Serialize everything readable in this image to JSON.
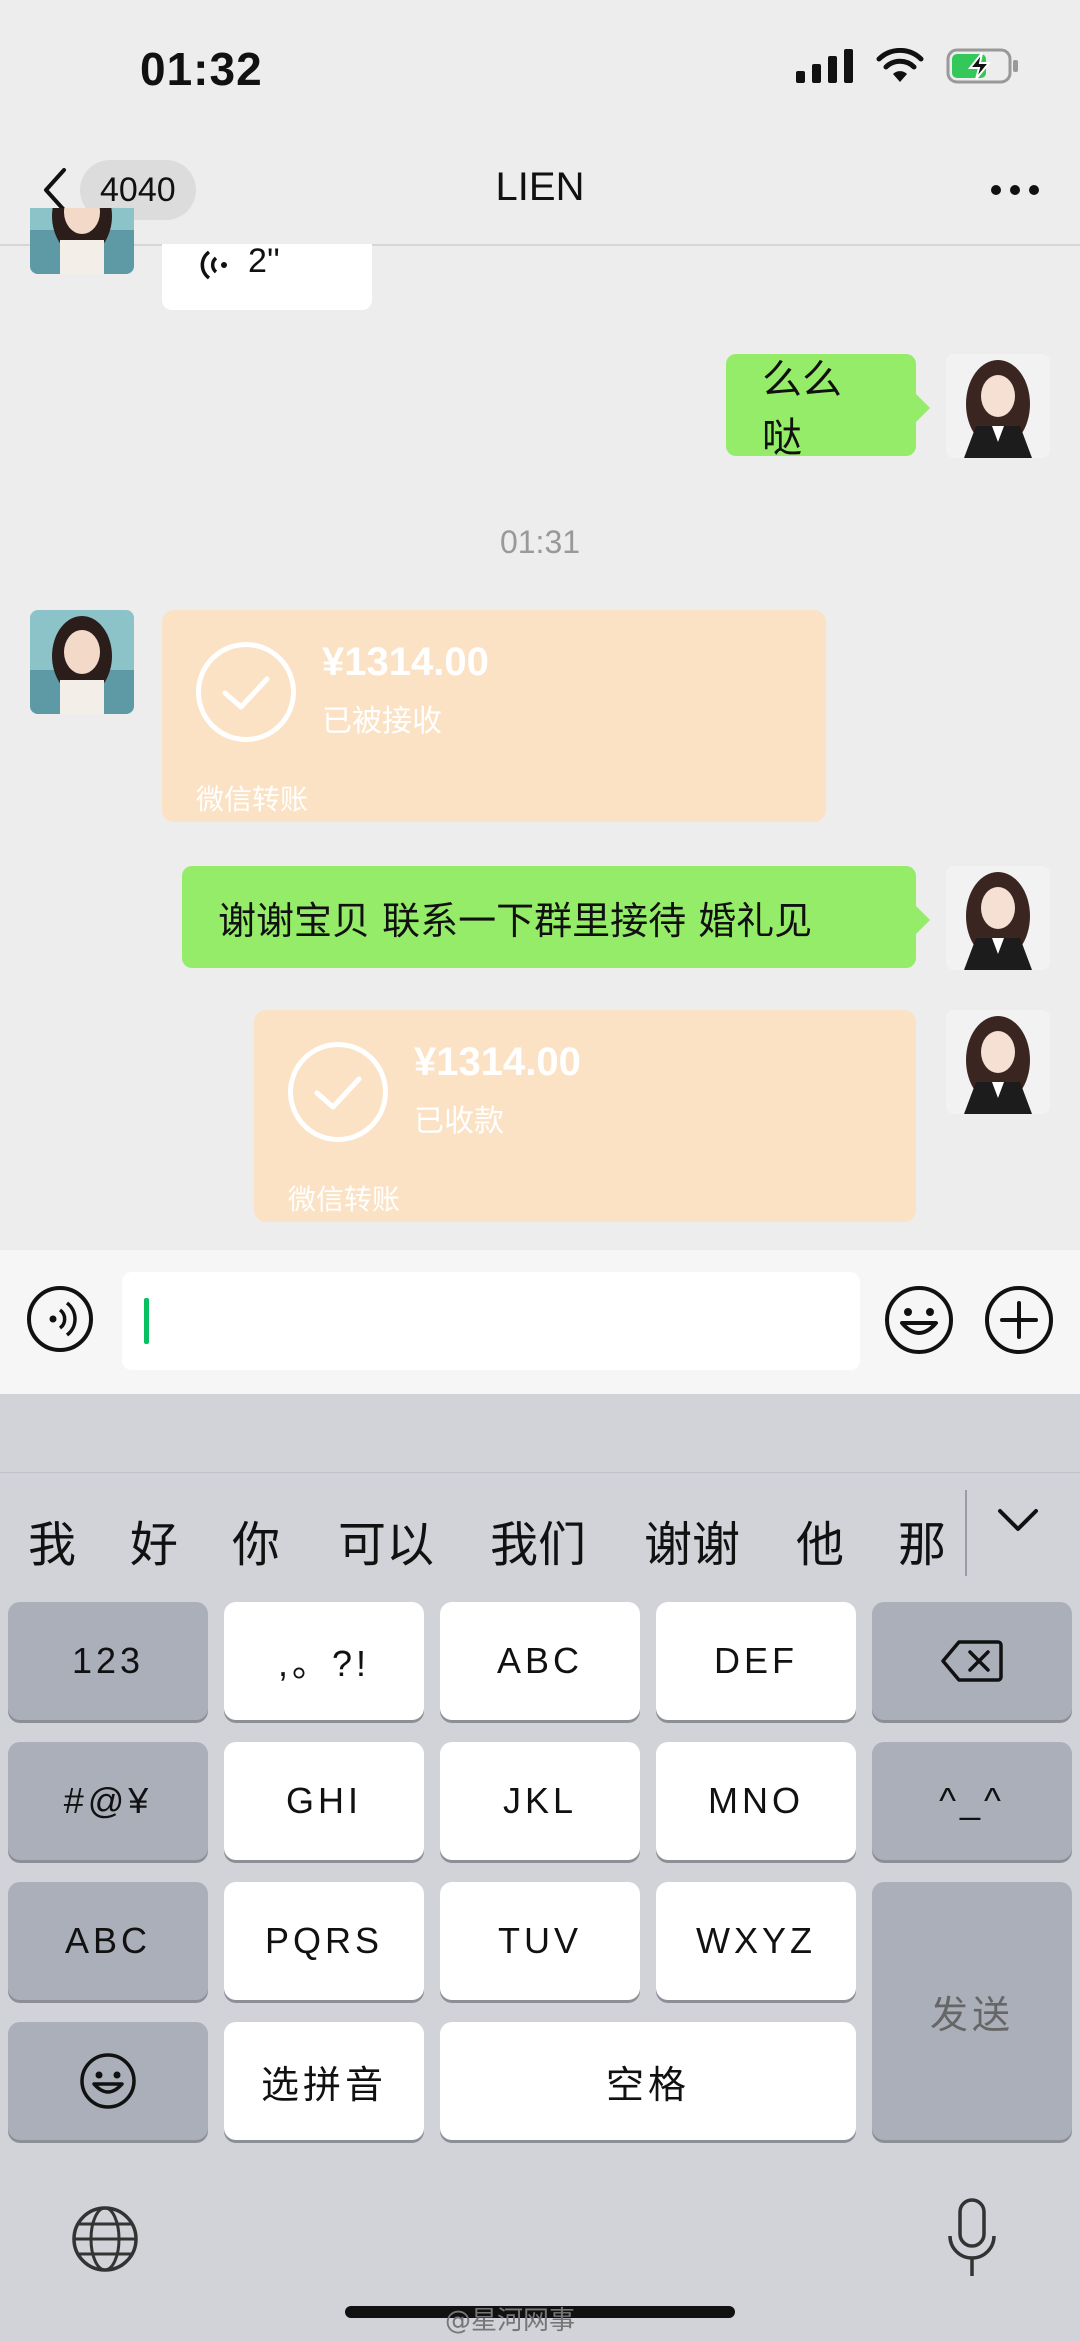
{
  "status_bar": {
    "time": "01:32"
  },
  "nav": {
    "badge": "4040",
    "title": "LIEN"
  },
  "messages": {
    "voice_duration": "2''",
    "green1": "么么哒",
    "timestamp": "01:31",
    "transfer1": {
      "amount": "¥1314.00",
      "status": "已被接收",
      "footer": "微信转账"
    },
    "green2": "谢谢宝贝 联系一下群里接待 婚礼见",
    "transfer2": {
      "amount": "¥1314.00",
      "status": "已收款",
      "footer": "微信转账"
    }
  },
  "candidates": [
    "我",
    "好",
    "你",
    "可以",
    "我们",
    "谢谢",
    "他",
    "那"
  ],
  "keys": {
    "num": "123",
    "punct": ",。?!",
    "abc_key": "ABC",
    "def": "DEF",
    "sym": "#@¥",
    "ghi": "GHI",
    "jkl": "JKL",
    "mno": "MNO",
    "kaomoji": "^_^",
    "abc": "ABC",
    "pqrs": "PQRS",
    "tuv": "TUV",
    "wxyz": "WXYZ",
    "send": "发送",
    "pinyin": "选拼音",
    "space": "空格"
  },
  "watermark": "@星河网事",
  "colors": {
    "bubble_green": "#95ec69",
    "transfer": "#fbe2c4",
    "caret": "#07c160"
  }
}
